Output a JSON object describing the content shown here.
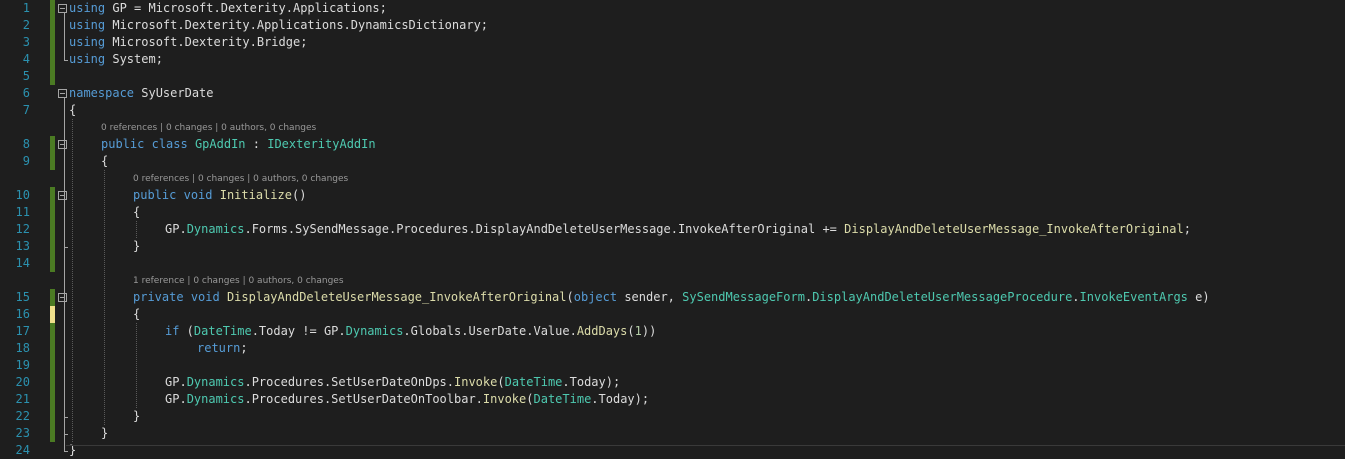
{
  "colors": {
    "background": "#1e1e1e",
    "line_number": "#2b91af",
    "keyword": "#569cd6",
    "type": "#4ec9b0",
    "method": "#dcdcaa",
    "number": "#b5cea8",
    "text": "#dcdcdc",
    "codelens": "#999999",
    "change_saved": "#4b7b23",
    "change_unsaved": "#efe08b"
  },
  "codelens": [
    {
      "line_before": 8,
      "text": "0 references | 0 changes | 0 authors, 0 changes"
    },
    {
      "line_before": 10,
      "text": "0 references | 0 changes | 0 authors, 0 changes"
    },
    {
      "line_before": 15,
      "text": "1 reference | 0 changes | 0 authors, 0 changes"
    }
  ],
  "lines": [
    {
      "n": "1",
      "change": "saved",
      "fold": true,
      "indent": 0,
      "tokens": [
        [
          "kw",
          "using"
        ],
        [
          "pl",
          " GP = Microsoft.Dexterity.Applications;"
        ]
      ]
    },
    {
      "n": "2",
      "change": "saved",
      "fold": false,
      "indent": 0,
      "tokens": [
        [
          "kw",
          "using"
        ],
        [
          "pl",
          " Microsoft.Dexterity.Applications.DynamicsDictionary;"
        ]
      ]
    },
    {
      "n": "3",
      "change": "saved",
      "fold": false,
      "indent": 0,
      "tokens": [
        [
          "kw",
          "using"
        ],
        [
          "pl",
          " Microsoft.Dexterity.Bridge;"
        ]
      ]
    },
    {
      "n": "4",
      "change": "saved",
      "fold": false,
      "indent": 0,
      "tokens": [
        [
          "kw",
          "using"
        ],
        [
          "pl",
          " System;"
        ]
      ]
    },
    {
      "n": "5",
      "change": "saved",
      "fold": false,
      "indent": 0,
      "tokens": []
    },
    {
      "n": "6",
      "change": "none",
      "fold": true,
      "indent": 0,
      "tokens": [
        [
          "kw",
          "namespace"
        ],
        [
          "pl",
          " SyUserDate"
        ]
      ]
    },
    {
      "n": "7",
      "change": "none",
      "fold": false,
      "indent": 0,
      "tokens": [
        [
          "pl",
          "{"
        ]
      ]
    },
    {
      "n": "8",
      "change": "saved",
      "fold": true,
      "indent": 1,
      "tokens": [
        [
          "kw",
          "public"
        ],
        [
          "pl",
          " "
        ],
        [
          "kw",
          "class"
        ],
        [
          "pl",
          " "
        ],
        [
          "ty",
          "GpAddIn"
        ],
        [
          "pl",
          " : "
        ],
        [
          "ty",
          "IDexterityAddIn"
        ]
      ]
    },
    {
      "n": "9",
      "change": "saved",
      "fold": false,
      "indent": 1,
      "tokens": [
        [
          "pl",
          "{"
        ]
      ]
    },
    {
      "n": "10",
      "change": "saved",
      "fold": true,
      "indent": 2,
      "tokens": [
        [
          "kw",
          "public"
        ],
        [
          "pl",
          " "
        ],
        [
          "kw",
          "void"
        ],
        [
          "pl",
          " "
        ],
        [
          "fn",
          "Initialize"
        ],
        [
          "pl",
          "()"
        ]
      ]
    },
    {
      "n": "11",
      "change": "saved",
      "fold": false,
      "indent": 2,
      "tokens": [
        [
          "pl",
          "{"
        ]
      ]
    },
    {
      "n": "12",
      "change": "saved",
      "fold": false,
      "indent": 3,
      "tokens": [
        [
          "pl",
          "GP."
        ],
        [
          "ty",
          "Dynamics"
        ],
        [
          "pl",
          ".Forms.SySendMessage.Procedures.DisplayAndDeleteUserMessage.InvokeAfterOriginal += "
        ],
        [
          "fn",
          "DisplayAndDeleteUserMessage_InvokeAfterOriginal"
        ],
        [
          "pl",
          ";"
        ]
      ]
    },
    {
      "n": "13",
      "change": "saved",
      "fold": false,
      "indent": 2,
      "tokens": [
        [
          "pl",
          "}"
        ]
      ]
    },
    {
      "n": "14",
      "change": "saved",
      "fold": false,
      "indent": 0,
      "tokens": []
    },
    {
      "n": "15",
      "change": "saved",
      "fold": true,
      "indent": 2,
      "tokens": [
        [
          "kw",
          "private"
        ],
        [
          "pl",
          " "
        ],
        [
          "kw",
          "void"
        ],
        [
          "pl",
          " "
        ],
        [
          "fn",
          "DisplayAndDeleteUserMessage_InvokeAfterOriginal"
        ],
        [
          "pl",
          "("
        ],
        [
          "kw",
          "object"
        ],
        [
          "pl",
          " sender, "
        ],
        [
          "ty",
          "SySendMessageForm"
        ],
        [
          "pl",
          "."
        ],
        [
          "ty",
          "DisplayAndDeleteUserMessageProcedure"
        ],
        [
          "pl",
          "."
        ],
        [
          "ty",
          "InvokeEventArgs"
        ],
        [
          "pl",
          " e)"
        ]
      ]
    },
    {
      "n": "16",
      "change": "unsaved",
      "fold": false,
      "indent": 2,
      "tokens": [
        [
          "pl",
          "{"
        ]
      ]
    },
    {
      "n": "17",
      "change": "saved",
      "fold": false,
      "indent": 3,
      "tokens": [
        [
          "kw",
          "if"
        ],
        [
          "pl",
          " ("
        ],
        [
          "ty",
          "DateTime"
        ],
        [
          "pl",
          ".Today != GP."
        ],
        [
          "ty",
          "Dynamics"
        ],
        [
          "pl",
          ".Globals.UserDate.Value."
        ],
        [
          "fn",
          "AddDays"
        ],
        [
          "pl",
          "("
        ],
        [
          "nm",
          "1"
        ],
        [
          "pl",
          "))"
        ]
      ]
    },
    {
      "n": "18",
      "change": "saved",
      "fold": false,
      "indent": 4,
      "tokens": [
        [
          "kw",
          "return"
        ],
        [
          "pl",
          ";"
        ]
      ]
    },
    {
      "n": "19",
      "change": "saved",
      "fold": false,
      "indent": 0,
      "tokens": []
    },
    {
      "n": "20",
      "change": "saved",
      "fold": false,
      "indent": 3,
      "tokens": [
        [
          "pl",
          "GP."
        ],
        [
          "ty",
          "Dynamics"
        ],
        [
          "pl",
          ".Procedures.SetUserDateOnDps."
        ],
        [
          "fn",
          "Invoke"
        ],
        [
          "pl",
          "("
        ],
        [
          "ty",
          "DateTime"
        ],
        [
          "pl",
          ".Today);"
        ]
      ]
    },
    {
      "n": "21",
      "change": "saved",
      "fold": false,
      "indent": 3,
      "tokens": [
        [
          "pl",
          "GP."
        ],
        [
          "ty",
          "Dynamics"
        ],
        [
          "pl",
          ".Procedures.SetUserDateOnToolbar."
        ],
        [
          "fn",
          "Invoke"
        ],
        [
          "pl",
          "("
        ],
        [
          "ty",
          "DateTime"
        ],
        [
          "pl",
          ".Today);"
        ]
      ]
    },
    {
      "n": "22",
      "change": "saved",
      "fold": false,
      "indent": 2,
      "tokens": [
        [
          "pl",
          "}"
        ]
      ]
    },
    {
      "n": "23",
      "change": "saved",
      "fold": false,
      "indent": 1,
      "tokens": [
        [
          "pl",
          "}"
        ]
      ]
    },
    {
      "n": "24",
      "change": "none",
      "fold": false,
      "indent": 0,
      "tokens": [
        [
          "pl",
          "}"
        ]
      ]
    }
  ]
}
